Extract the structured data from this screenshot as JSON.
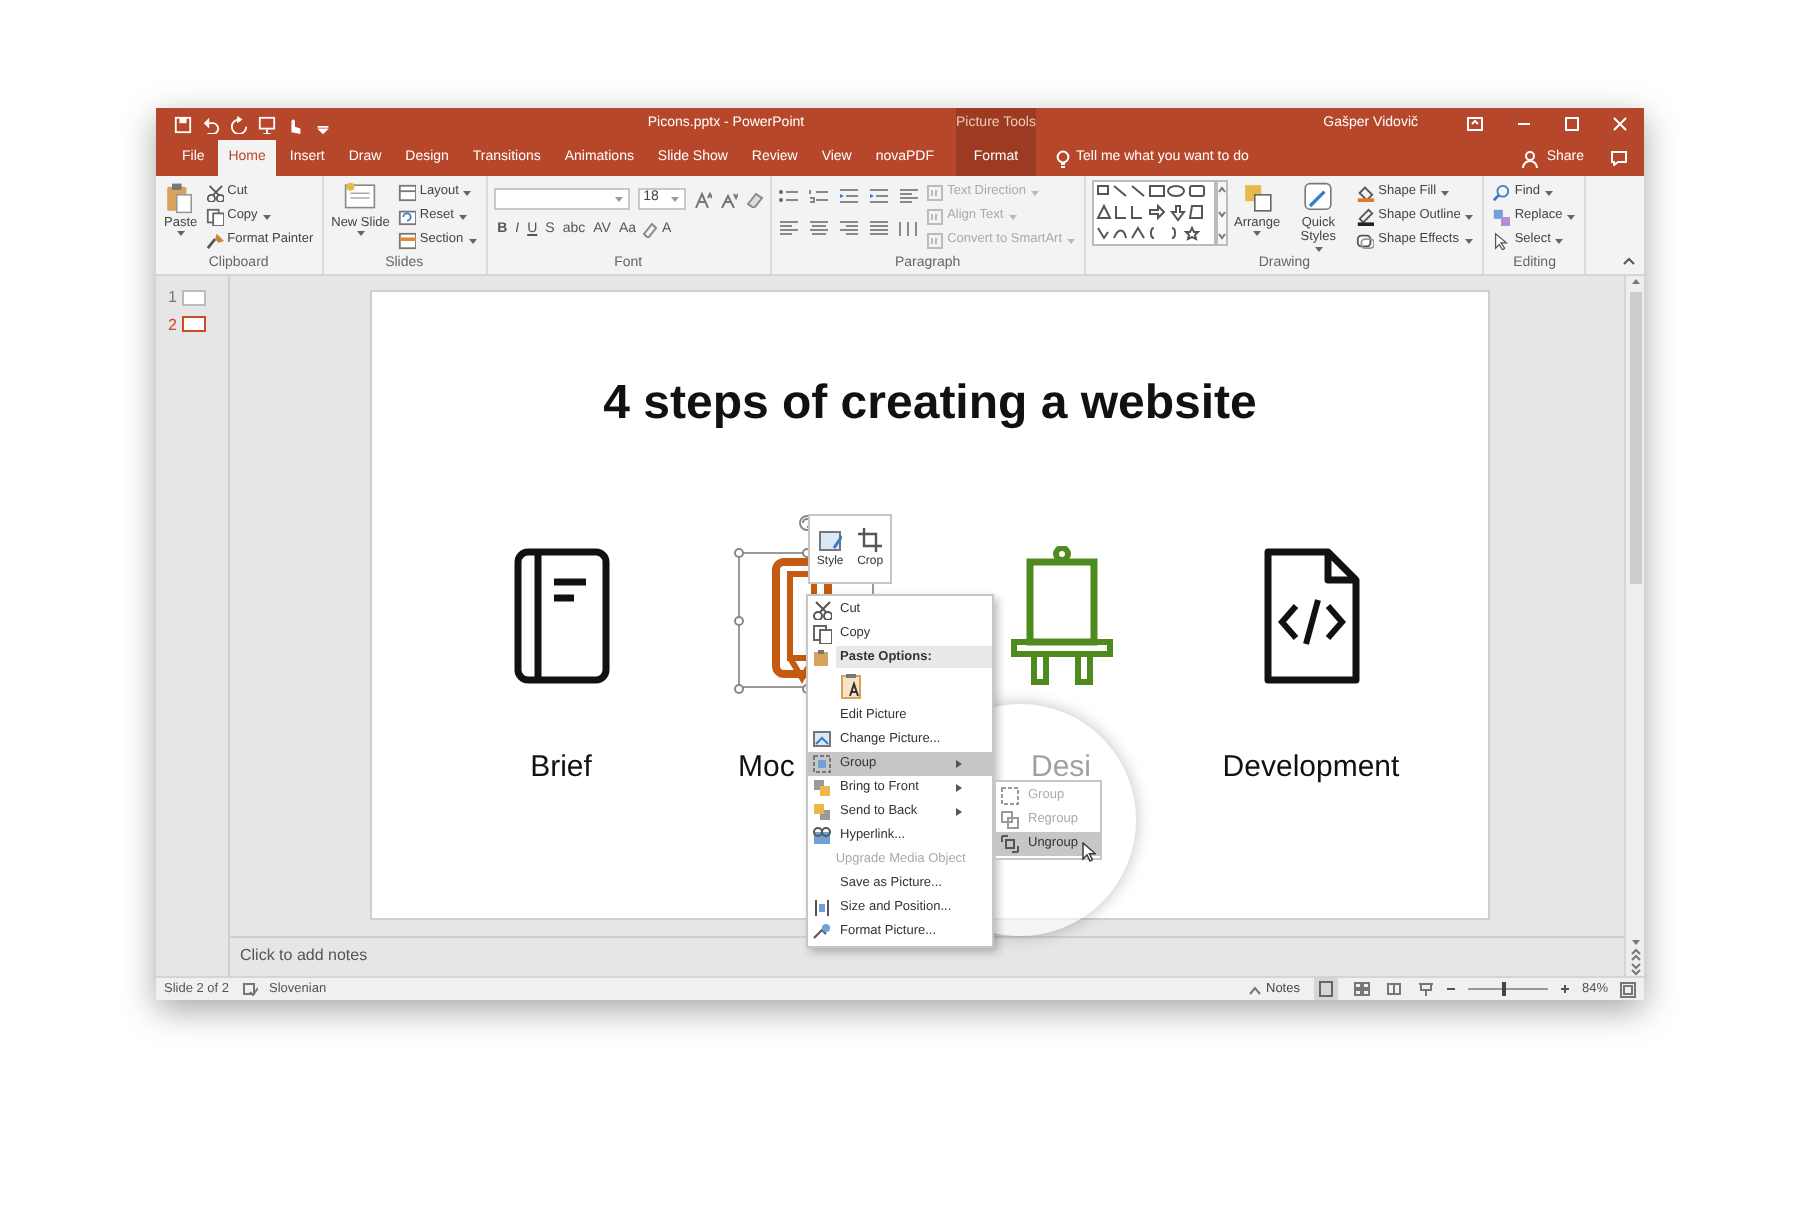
{
  "window": {
    "title": "Picons.pptx - PowerPoint",
    "context_group": "Picture Tools",
    "user": "Gašper Vidovič"
  },
  "tabs": [
    {
      "label": "File",
      "selected": false,
      "kind": "normal"
    },
    {
      "label": "Home",
      "selected": true,
      "kind": "normal"
    },
    {
      "label": "Insert",
      "selected": false,
      "kind": "normal"
    },
    {
      "label": "Draw",
      "selected": false,
      "kind": "normal"
    },
    {
      "label": "Design",
      "selected": false,
      "kind": "normal"
    },
    {
      "label": "Transitions",
      "selected": false,
      "kind": "normal"
    },
    {
      "label": "Animations",
      "selected": false,
      "kind": "normal"
    },
    {
      "label": "Slide Show",
      "selected": false,
      "kind": "normal"
    },
    {
      "label": "Review",
      "selected": false,
      "kind": "normal"
    },
    {
      "label": "View",
      "selected": false,
      "kind": "normal"
    },
    {
      "label": "novaPDF",
      "selected": false,
      "kind": "normal"
    },
    {
      "label": "Format",
      "selected": false,
      "kind": "contextual"
    }
  ],
  "tell_me": {
    "placeholder": "Tell me what you want to do"
  },
  "share": {
    "label": "Share"
  },
  "ribbon": [
    {
      "label": "Clipboard",
      "kind": "buttons",
      "items": [
        {
          "label": "Paste",
          "kind": "large"
        },
        {
          "label": "Cut",
          "kind": "small"
        },
        {
          "label": "Copy",
          "kind": "small"
        },
        {
          "label": "Format Painter",
          "kind": "small"
        }
      ]
    },
    {
      "label": "Slides",
      "kind": "buttons",
      "items": [
        {
          "label": "New Slide",
          "kind": "large"
        },
        {
          "label": "Layout",
          "kind": "small"
        },
        {
          "label": "Reset",
          "kind": "small"
        },
        {
          "label": "Section",
          "kind": "small"
        }
      ]
    },
    {
      "label": "Font",
      "kind": "font",
      "font_size": "18",
      "format_buttons": [
        "B",
        "I",
        "U",
        "S",
        "abc",
        "AV",
        "Aa",
        "A"
      ]
    },
    {
      "label": "Paragraph",
      "kind": "paragraph",
      "items": [
        {
          "label": "Text Direction",
          "disabled": true
        },
        {
          "label": "Align Text",
          "disabled": true
        },
        {
          "label": "Convert to SmartArt",
          "disabled": true
        }
      ]
    },
    {
      "label": "Drawing",
      "kind": "drawing",
      "items": [
        {
          "label": "Arrange",
          "kind": "large"
        },
        {
          "label": "Quick Styles",
          "kind": "large"
        },
        {
          "label": "Shape Fill",
          "kind": "small"
        },
        {
          "label": "Shape Outline",
          "kind": "small"
        },
        {
          "label": "Shape Effects",
          "kind": "small"
        }
      ]
    },
    {
      "label": "Editing",
      "kind": "buttons",
      "items": [
        {
          "label": "Find",
          "kind": "small"
        },
        {
          "label": "Replace",
          "kind": "small"
        },
        {
          "label": "Select",
          "kind": "small"
        }
      ]
    }
  ],
  "thumbnails": [
    {
      "number": "1",
      "selected": false
    },
    {
      "number": "2",
      "selected": true
    }
  ],
  "slide": {
    "title": "4 steps of creating a website",
    "steps": [
      {
        "label": "Brief",
        "color": "#111111",
        "selected": false
      },
      {
        "label": "Moc",
        "color": "#c55a11",
        "selected": true
      },
      {
        "label": "Desi",
        "color": "#4e8a1e",
        "selected": false
      },
      {
        "label": "Development",
        "color": "#111111",
        "selected": false
      }
    ]
  },
  "mini_toolbar": [
    {
      "label": "Style"
    },
    {
      "label": "Crop"
    }
  ],
  "context_menu": [
    {
      "kind": "item",
      "label": "Cut",
      "disabled": false,
      "selected": false,
      "submenu": false
    },
    {
      "kind": "item",
      "label": "Copy",
      "disabled": false,
      "selected": false,
      "submenu": false
    },
    {
      "kind": "header",
      "label": "Paste Options:"
    },
    {
      "kind": "paste_option"
    },
    {
      "kind": "item",
      "label": "Edit Picture",
      "disabled": false,
      "selected": false,
      "submenu": false
    },
    {
      "kind": "item",
      "label": "Change Picture...",
      "disabled": false,
      "selected": false,
      "submenu": false
    },
    {
      "kind": "item",
      "label": "Group",
      "disabled": false,
      "selected": true,
      "submenu": true
    },
    {
      "kind": "item",
      "label": "Bring to Front",
      "disabled": false,
      "selected": false,
      "submenu": true
    },
    {
      "kind": "item",
      "label": "Send to Back",
      "disabled": false,
      "selected": false,
      "submenu": true
    },
    {
      "kind": "item",
      "label": "Hyperlink...",
      "disabled": false,
      "selected": false,
      "submenu": false
    },
    {
      "kind": "item",
      "label": "Upgrade Media Object",
      "disabled": true,
      "selected": false,
      "submenu": false
    },
    {
      "kind": "item",
      "label": "Save as Picture...",
      "disabled": false,
      "selected": false,
      "submenu": false
    },
    {
      "kind": "item",
      "label": "Size and Position...",
      "disabled": false,
      "selected": false,
      "submenu": false
    },
    {
      "kind": "item",
      "label": "Format Picture...",
      "disabled": false,
      "selected": false,
      "submenu": false
    }
  ],
  "submenu": [
    {
      "label": "Group",
      "disabled": true,
      "selected": false
    },
    {
      "label": "Regroup",
      "disabled": true,
      "selected": false
    },
    {
      "label": "Ungroup",
      "disabled": false,
      "selected": true
    }
  ],
  "notes": {
    "placeholder": "Click to add notes"
  },
  "status_bar": {
    "slide": "Slide 2 of 2",
    "language": "Slovenian",
    "notes": "Notes",
    "zoom": "84%",
    "zoom_slider": {
      "level": 0.45
    }
  }
}
